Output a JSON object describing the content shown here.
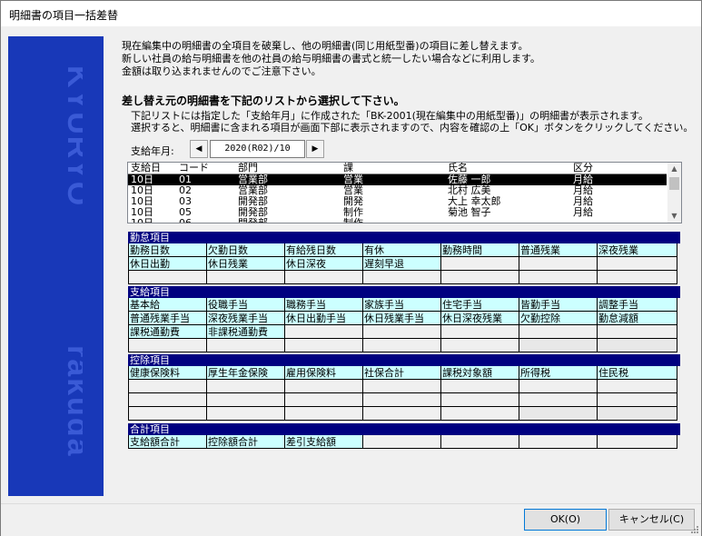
{
  "window": {
    "title": "明細書の項目一括差替"
  },
  "brand": {
    "top": "KYURYO",
    "bottom": "rakuda"
  },
  "intro": {
    "line1": "現在編集中の明細書の全項目を破棄し、他の明細書(同じ用紙型番)の項目に差し替えます。",
    "line2": "新しい社員の給与明細書を他の社員の給与明細書の書式と統一したい場合などに利用します。",
    "line3": "金額は取り込まれませんのでご注意下さい。"
  },
  "select": {
    "heading": "差し替え元の明細書を下記のリストから選択して下さい。",
    "sub1": "下記リストには指定した「支給年月」に作成された「BK-2001(現在編集中の用紙型番)」の明細書が表示されます。",
    "sub2": "選択すると、明細書に含まれる項目が画面下部に表示されますので、内容を確認の上「OK」ボタンをクリックしてください。"
  },
  "period": {
    "label": "支給年月:",
    "value": "2020(R02)/10",
    "prev": "◀",
    "next": "▶"
  },
  "list": {
    "headers": [
      "支給日",
      "コード",
      "部門",
      "課",
      "氏名",
      "区分"
    ],
    "rows": [
      {
        "day": "10日",
        "code": "01",
        "dept": "営業部",
        "section": "営業",
        "name": "佐藤 一郎",
        "type": "月給",
        "selected": true
      },
      {
        "day": "10日",
        "code": "02",
        "dept": "営業部",
        "section": "営業",
        "name": "北村 広美",
        "type": "月給",
        "selected": false
      },
      {
        "day": "10日",
        "code": "03",
        "dept": "開発部",
        "section": "開発",
        "name": "大上 幸太郎",
        "type": "月給",
        "selected": false
      },
      {
        "day": "10日",
        "code": "05",
        "dept": "開発部",
        "section": "制作",
        "name": "菊池 智子",
        "type": "月給",
        "selected": false
      },
      {
        "day": "10日",
        "code": "06",
        "dept": "開発部",
        "section": "制作",
        "name": "",
        "type": "",
        "selected": false
      }
    ]
  },
  "groups": {
    "attendance": {
      "title": "勤怠項目",
      "rows": [
        [
          "勤務日数",
          "欠勤日数",
          "有給残日数",
          "有休",
          "勤務時間",
          "普通残業",
          "深夜残業"
        ],
        [
          "休日出勤",
          "休日残業",
          "休日深夜",
          "遅刻早退",
          "",
          "",
          ""
        ],
        [
          "",
          "",
          "",
          "",
          "",
          "",
          ""
        ]
      ]
    },
    "payment": {
      "title": "支給項目",
      "rows": [
        [
          "基本給",
          "役職手当",
          "職務手当",
          "家族手当",
          "住宅手当",
          "皆勤手当",
          "調整手当"
        ],
        [
          "普通残業手当",
          "深夜残業手当",
          "休日出勤手当",
          "休日残業手当",
          "休日深夜残業",
          "欠勤控除",
          "勤怠減額"
        ],
        [
          "課税通勤費",
          "非課税通勤費",
          "",
          "",
          "",
          "",
          ""
        ],
        [
          "",
          "",
          "",
          "",
          "",
          "",
          ""
        ]
      ]
    },
    "deduction": {
      "title": "控除項目",
      "rows": [
        [
          "健康保険料",
          "厚生年金保険",
          "雇用保険料",
          "社保合計",
          "課税対象額",
          "所得税",
          "住民税"
        ],
        [
          "",
          "",
          "",
          "",
          "",
          "",
          ""
        ],
        [
          "",
          "",
          "",
          "",
          "",
          "",
          ""
        ],
        [
          "",
          "",
          "",
          "",
          "",
          "",
          ""
        ]
      ]
    },
    "total": {
      "title": "合計項目",
      "rows": [
        [
          "支給額合計",
          "控除額合計",
          "差引支給額",
          "",
          "",
          "",
          ""
        ]
      ]
    }
  },
  "buttons": {
    "ok": "OK(O)",
    "cancel": "キャンセル(C)"
  },
  "colors": {
    "sidebar": "#1838b8",
    "group_header": "#000080",
    "filled_cell": "#ccffff",
    "selection": "#000000"
  }
}
